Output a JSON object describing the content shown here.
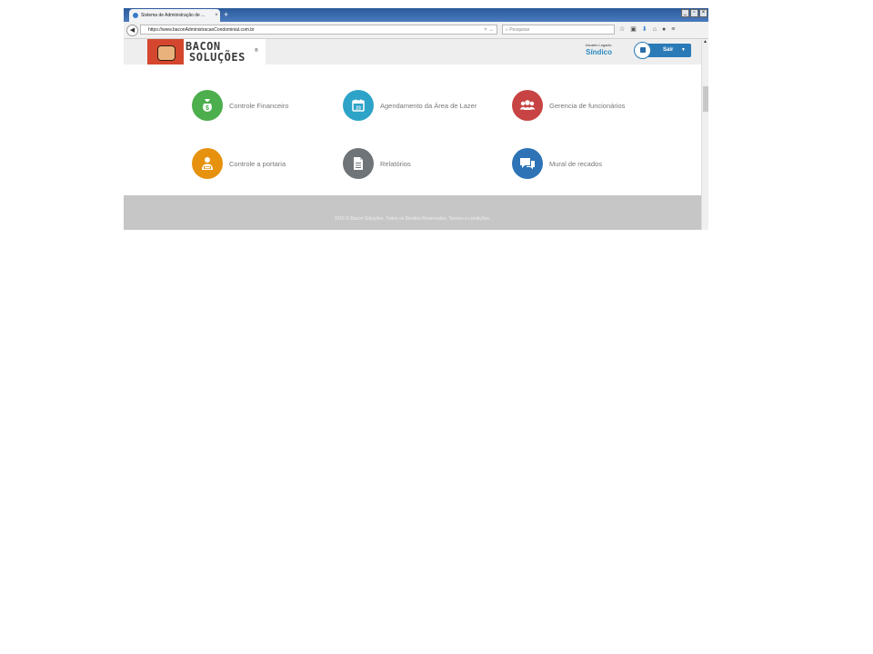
{
  "browser": {
    "tab_title": "Sistema de Administração de ...",
    "tab_close": "×",
    "new_tab": "+",
    "url": "https://www.baconAdministracaoCondominial.com.br",
    "search_placeholder": "Pesquisar"
  },
  "header": {
    "logo_line1": "BACON",
    "logo_line2": "SOLUÇÕES",
    "logo_reg": "®",
    "user_label": "Usuário Logado:",
    "user_name": "Síndico",
    "logout_label": "Sair"
  },
  "menu": [
    {
      "label": "Controle Financeiro",
      "color": "#4cae4c",
      "icon": "money-bag-icon"
    },
    {
      "label": "Agendamento da Área de Lazer",
      "color": "#2ea3c8",
      "icon": "calendar-icon"
    },
    {
      "label": "Gerencia de funcionários",
      "color": "#c84343",
      "icon": "users-icon"
    },
    {
      "label": "Controle a portaria",
      "color": "#e6920f",
      "icon": "doorman-icon"
    },
    {
      "label": "Relatórios",
      "color": "#6f7479",
      "icon": "document-icon"
    },
    {
      "label": "Mural de recados",
      "color": "#2e73b6",
      "icon": "chat-icon"
    }
  ],
  "calendar_day": "23",
  "footer": {
    "copyright": "2016 © Bacon Soluções. Todos os Direitos Reservados. Termos e condições."
  }
}
